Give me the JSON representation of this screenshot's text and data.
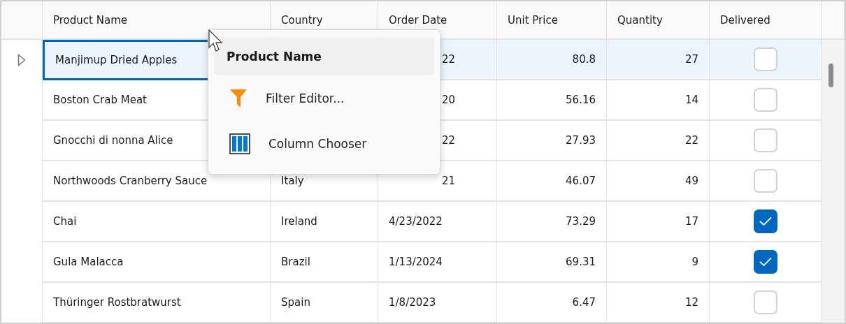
{
  "columns": [
    "Product Name",
    "Country",
    "Order Date",
    "Unit Price",
    "Quantity",
    "Delivered"
  ],
  "rows": [
    {
      "selected": true,
      "product": "Manjimup Dried Apples",
      "product_focused": true,
      "date": "22",
      "date_partial": true,
      "price": "80.8",
      "quantity": "27",
      "delivered": false
    },
    {
      "selected": false,
      "product": "Boston Crab Meat",
      "product_focused": false,
      "date": "20",
      "date_partial": true,
      "price": "56.16",
      "quantity": "14",
      "delivered": false
    },
    {
      "selected": false,
      "product": "Gnocchi di nonna Alice",
      "product_focused": false,
      "date": "22",
      "date_partial": true,
      "price": "27.93",
      "quantity": "22",
      "delivered": false
    },
    {
      "selected": false,
      "product": "Northwoods Cranberry Sauce",
      "product_focused": false,
      "country": "Italy",
      "date": "21",
      "date_partial": true,
      "price": "46.07",
      "quantity": "49",
      "delivered": false
    },
    {
      "selected": false,
      "product": "Chai",
      "product_focused": false,
      "country": "Ireland",
      "date": "4/23/2022",
      "date_partial": false,
      "price": "73.29",
      "quantity": "17",
      "delivered": true
    },
    {
      "selected": false,
      "product": "Gula Malacca",
      "product_focused": false,
      "country": "Brazil",
      "date": "1/13/2024",
      "date_partial": false,
      "price": "69.31",
      "quantity": "9",
      "delivered": true
    },
    {
      "selected": false,
      "product": "Thüringer Rostbratwurst",
      "product_focused": false,
      "country": "Spain",
      "date": "1/8/2023",
      "date_partial": false,
      "price": "6.47",
      "quantity": "12",
      "delivered": false
    }
  ],
  "context_menu": {
    "title": "Product Name",
    "items": [
      {
        "kind": "filter",
        "label": "Filter Editor..."
      },
      {
        "kind": "columns",
        "label": "Column Chooser"
      }
    ]
  }
}
